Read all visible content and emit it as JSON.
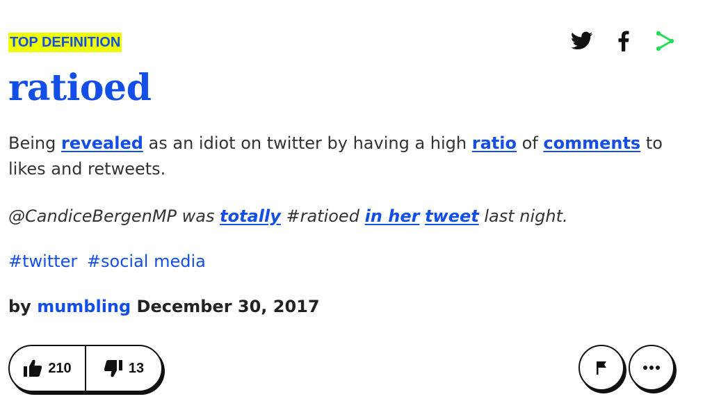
{
  "badge": {
    "label": "TOP DEFINITION"
  },
  "share": {
    "icons": [
      "twitter-icon",
      "facebook-icon",
      "share-icon"
    ],
    "share_color": "#22dd55"
  },
  "word": "ratioed",
  "meaning": {
    "t1": "Being ",
    "link1": "revealed",
    "t2": " as an idiot on twitter by having a high ",
    "link2": "ratio",
    "t3": " of ",
    "link3": "comments",
    "t4": " to likes and retweets."
  },
  "example": {
    "t1": "@CandiceBergenMP was ",
    "link1": "totally",
    "t2": " #ratioed ",
    "link2": "in her",
    "t3": " ",
    "link3": "tweet",
    "t4": " last night."
  },
  "tags": [
    "#twitter",
    "#social media"
  ],
  "byline": {
    "prefix": "by ",
    "author": "mumbling",
    "date": " December 30, 2017"
  },
  "votes": {
    "up": "210",
    "down": "13"
  },
  "colors": {
    "accent": "#134fe6",
    "highlight": "#efff00"
  }
}
